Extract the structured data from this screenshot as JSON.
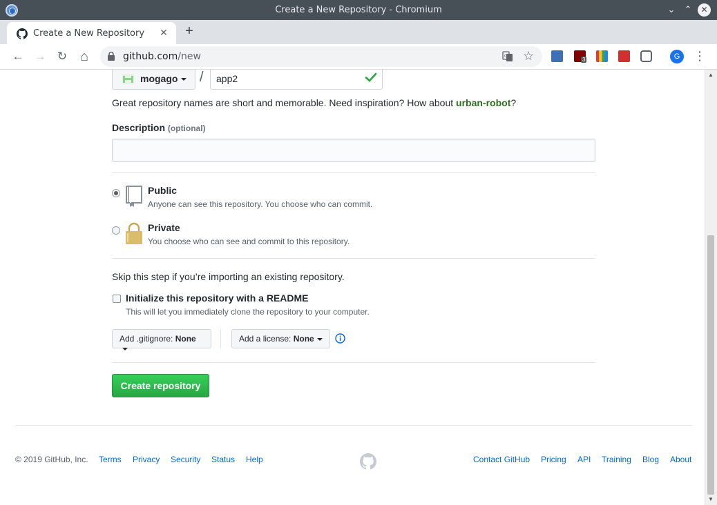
{
  "window": {
    "title": "Create a New Repository - Chromium"
  },
  "tab": {
    "title": "Create a New Repository",
    "close": "✕",
    "new_tab": "+"
  },
  "toolbar": {
    "back": "←",
    "forward": "→",
    "reload": "↻",
    "home": "⌂",
    "url_host": "github.com",
    "url_path": "/new",
    "star": "☆",
    "menu": "⋮",
    "profile_initial": "G",
    "ublock_badge": "3"
  },
  "form": {
    "owner": "mogago",
    "separator": "/",
    "repo_name": "app2",
    "inspiration_prefix": "Great repository names are short and memorable. Need inspiration? How about ",
    "inspiration_suggestion": "urban-robot",
    "inspiration_suffix": "?",
    "description_label": "Description",
    "description_optional": "(optional)",
    "description_value": "",
    "visibility": [
      {
        "title": "Public",
        "note": "Anyone can see this repository. You choose who can commit.",
        "checked": true
      },
      {
        "title": "Private",
        "note": "You choose who can see and commit to this repository.",
        "checked": false
      }
    ],
    "skip_text": "Skip this step if you’re importing an existing repository.",
    "init_label": "Initialize this repository with a README",
    "init_note": "This will let you immediately clone the repository to your computer.",
    "init_checked": false,
    "gitignore_prefix": "Add .gitignore: ",
    "gitignore_value": "None",
    "license_prefix": "Add a license: ",
    "license_value": "None",
    "create_button": "Create repository"
  },
  "footer": {
    "copyright": "© 2019 GitHub, Inc.",
    "left_links": [
      "Terms",
      "Privacy",
      "Security",
      "Status",
      "Help"
    ],
    "right_links": [
      "Contact GitHub",
      "Pricing",
      "API",
      "Training",
      "Blog",
      "About"
    ]
  },
  "colors": {
    "create_button": "#2ea44f",
    "link": "#0366d6",
    "suggestion": "#2c6e1e",
    "titlebar": "#475057"
  }
}
